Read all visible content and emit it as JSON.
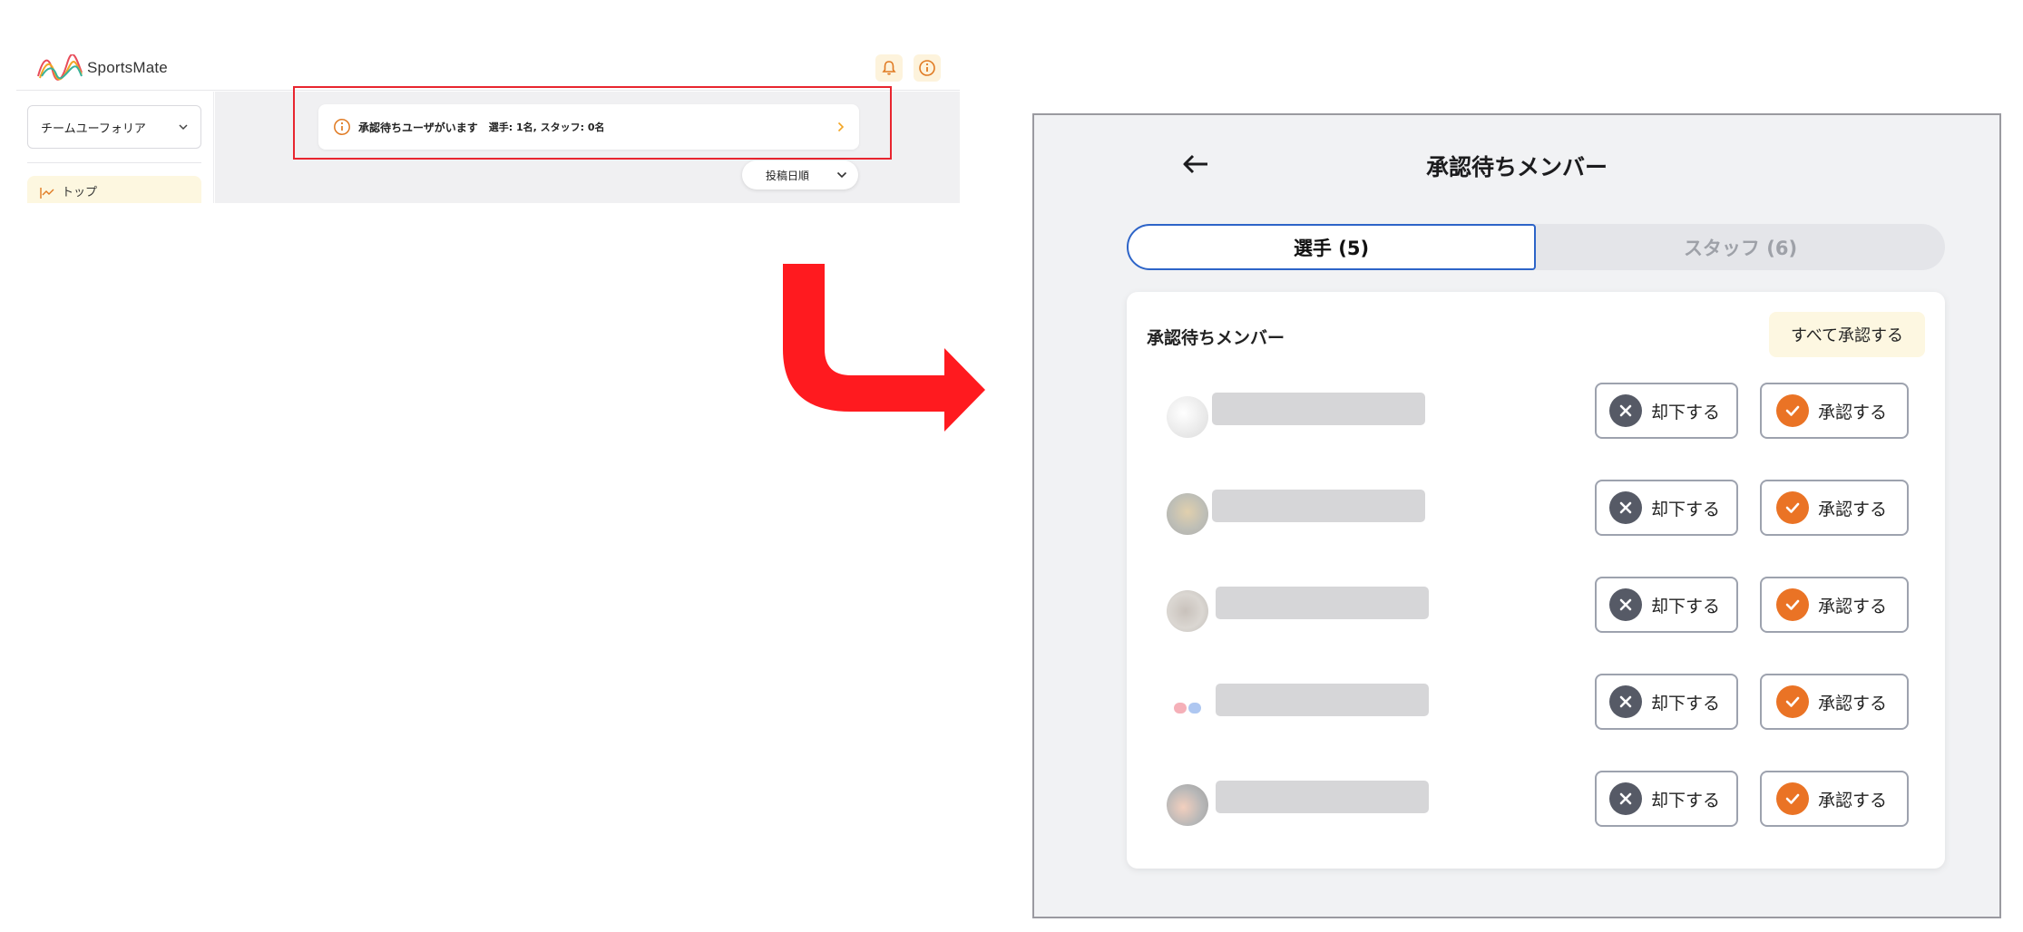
{
  "app": {
    "logo_text": "SportsMate",
    "team_select": "チームユーフォリア",
    "sidebar_top": "トップ",
    "notice": {
      "title": "承認待ちユーザがいます",
      "detail": "選手: 1名, スタッフ: 0名"
    },
    "sort_label": "投稿日順"
  },
  "modal": {
    "title": "承認待ちメンバー",
    "tabs": [
      {
        "label": "選手 (5)",
        "selected": true
      },
      {
        "label": "スタッフ (6)",
        "selected": false
      }
    ],
    "card_title": "承認待ちメンバー",
    "approve_all_label": "すべて承認する",
    "members": [
      {
        "reject_label": "却下する",
        "approve_label": "承認する"
      },
      {
        "reject_label": "却下する",
        "approve_label": "承認する"
      },
      {
        "reject_label": "却下する",
        "approve_label": "承認する"
      },
      {
        "reject_label": "却下する",
        "approve_label": "承認する"
      },
      {
        "reject_label": "却下する",
        "approve_label": "承認する"
      }
    ]
  },
  "colors": {
    "accent_orange": "#ea7325",
    "highlight_red": "#e8252f",
    "tab_border_blue": "#2d64c8",
    "reject_gray": "#565a66"
  },
  "icons": [
    "logo-icon",
    "bell-icon",
    "info-icon",
    "chevron-down-icon",
    "chart-icon",
    "chevron-right-icon",
    "back-arrow-icon",
    "close-icon",
    "check-icon",
    "flow-arrow-icon"
  ]
}
